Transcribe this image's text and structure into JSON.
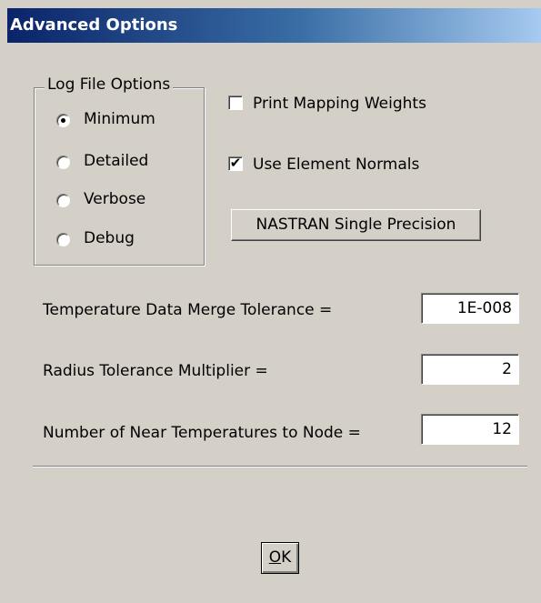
{
  "window": {
    "title": "Advanced Options"
  },
  "log_file_options": {
    "legend": "Log File Options",
    "selected": "Minimum",
    "options": [
      {
        "label": "Minimum",
        "checked": true
      },
      {
        "label": "Detailed",
        "checked": false
      },
      {
        "label": "Verbose",
        "checked": false
      },
      {
        "label": "Debug",
        "checked": false
      }
    ]
  },
  "checkboxes": {
    "print_mapping_weights": {
      "label": "Print Mapping Weights",
      "checked": false
    },
    "use_element_normals": {
      "label": "Use Element Normals",
      "checked": true
    }
  },
  "buttons": {
    "nastran": "NASTRAN Single Precision",
    "ok_accel": "O",
    "ok_rest": "K"
  },
  "fields": {
    "merge_tolerance": {
      "label": "Temperature Data Merge Tolerance =",
      "value": "1E-008"
    },
    "radius_multiplier": {
      "label": "Radius Tolerance Multiplier =",
      "value": "2"
    },
    "near_temperatures": {
      "label": "Number of Near Temperatures to Node =",
      "value": "12"
    }
  }
}
